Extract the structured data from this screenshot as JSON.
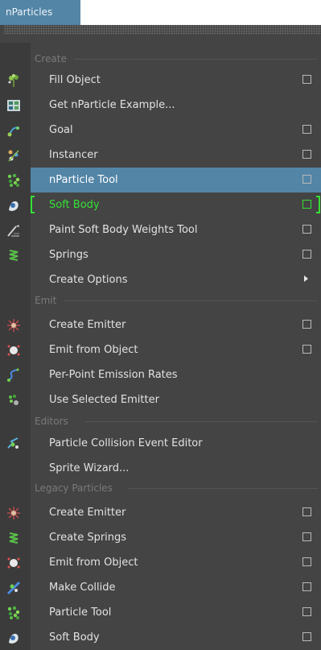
{
  "tab": {
    "label": "nParticles"
  },
  "colors": {
    "highlight": "#5285a6",
    "active_green": "#35e235",
    "panel_bg": "#444444",
    "gutter_bg": "#3b3b3b"
  },
  "sections": {
    "create": "Create",
    "emit": "Emit",
    "editors": "Editors",
    "legacy": "Legacy Particles"
  },
  "items": {
    "fill_object": {
      "label": "Fill Object",
      "icon": "fill-object-icon"
    },
    "get_example": {
      "label": "Get nParticle Example...",
      "icon": "example-icon"
    },
    "goal": {
      "label": "Goal",
      "icon": "goal-icon"
    },
    "instancer": {
      "label": "Instancer",
      "icon": "instancer-icon"
    },
    "nparticle_tool": {
      "label": "nParticle Tool",
      "icon": "nparticle-tool-icon",
      "highlighted": true
    },
    "soft_body": {
      "label": "Soft Body",
      "icon": "soft-body-icon",
      "active": true
    },
    "paint_soft_body": {
      "label": "Paint Soft Body Weights Tool",
      "icon": "paint-brush-icon"
    },
    "springs": {
      "label": "Springs",
      "icon": "springs-icon"
    },
    "create_options": {
      "label": "Create Options",
      "icon": ""
    },
    "create_emitter": {
      "label": "Create Emitter",
      "icon": "emitter-icon"
    },
    "emit_from_object": {
      "label": "Emit from Object",
      "icon": "emit-from-object-icon"
    },
    "per_point": {
      "label": "Per-Point Emission Rates",
      "icon": "emission-rates-icon"
    },
    "use_selected_emitter": {
      "label": "Use Selected Emitter",
      "icon": "selected-emitter-icon"
    },
    "collision_event_editor": {
      "label": "Particle Collision Event Editor",
      "icon": "collision-event-icon"
    },
    "sprite_wizard": {
      "label": "Sprite Wizard...",
      "icon": ""
    },
    "legacy_create_emitter": {
      "label": "Create Emitter",
      "icon": "emitter-icon"
    },
    "legacy_create_springs": {
      "label": "Create Springs",
      "icon": "springs-icon"
    },
    "legacy_emit_from_object": {
      "label": "Emit from Object",
      "icon": "emit-from-object-icon"
    },
    "legacy_make_collide": {
      "label": "Make Collide",
      "icon": "make-collide-icon"
    },
    "legacy_particle_tool": {
      "label": "Particle Tool",
      "icon": "particle-tool-icon"
    },
    "legacy_soft_body": {
      "label": "Soft Body",
      "icon": "soft-body-icon"
    }
  }
}
